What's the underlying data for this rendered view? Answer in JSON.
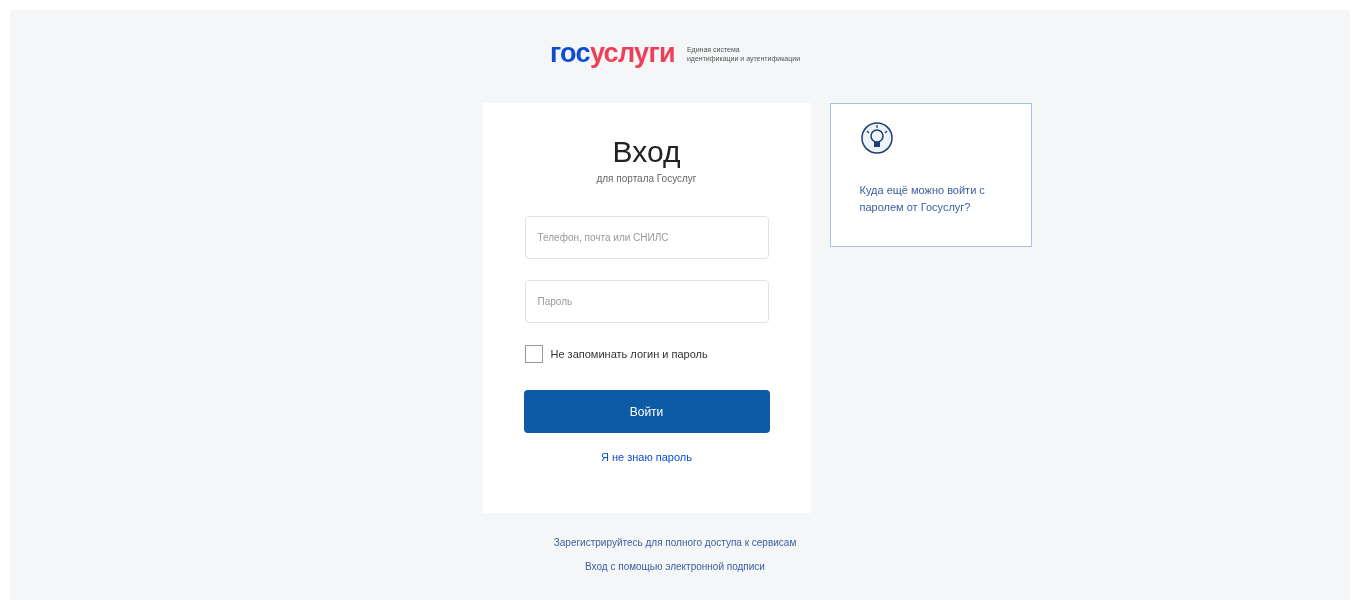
{
  "logo": {
    "part_1": "гос",
    "part_2": "услуги",
    "subtitle_line_1": "Единая система",
    "subtitle_line_2": "идентификации и аутентификации"
  },
  "login": {
    "title": "Вход",
    "subtitle": "для портала Госуслуг",
    "fields": [
      {
        "placeholder": "Телефон, почта или СНИЛС"
      },
      {
        "placeholder": "Пароль"
      }
    ],
    "remember": {
      "label": "Не запоминать логин и пароль",
      "checked": false
    },
    "submit": "Войти",
    "forgot": "Я не знаю пароль"
  },
  "info_card": {
    "text": "Куда ещё можно войти с паролем от Госуслуг?"
  },
  "footer_links": [
    "Зарегистрируйтесь для полного доступа к сервисам",
    "Вход с помощью электронной подписи"
  ]
}
